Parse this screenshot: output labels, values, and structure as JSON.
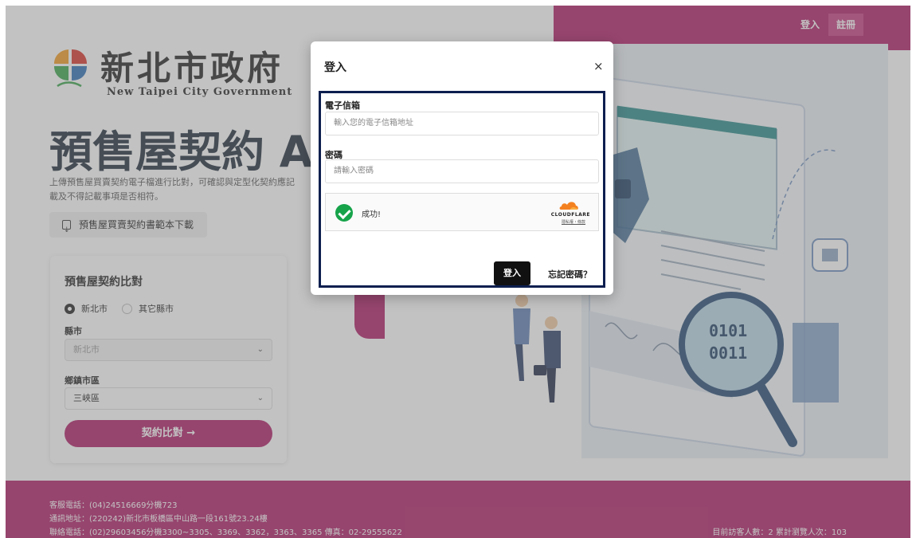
{
  "header": {
    "login_label": "登入",
    "register_label": "註冊"
  },
  "logo": {
    "name_cn": "新北市政府",
    "name_en": "New Taipei City Government"
  },
  "hero": {
    "title": "預售屋契約 AI",
    "description": "上傳預售屋買賣契約電子檔進行比對，可確認與定型化契約應記載及不得記載事項是否相符。",
    "download_label": "預售屋買賣契約書範本下載"
  },
  "compare_card": {
    "title": "預售屋契約比對",
    "radio_options": [
      "新北市",
      "其它縣市"
    ],
    "selected_option": "新北市",
    "county_label": "縣市",
    "county_value": "新北市",
    "district_label": "鄉鎮市區",
    "district_value": "三峽區",
    "submit_label": "契約比對 →"
  },
  "footer": {
    "phone": "客服電話：(04)24516669分機723",
    "address": "通訊地址：(220242)新北市板橋區中山路一段161號23.24樓",
    "contact": "聯絡電話：(02)29603456分機3300~3305、3369、3362，3363、3365 傳真：02-29555622",
    "visits": "目前訪客人數：2 累計瀏覽人次：103"
  },
  "modal": {
    "title": "登入",
    "close_symbol": "×",
    "email_label": "電子信箱",
    "email_placeholder": "輸入您的電子信箱地址",
    "password_label": "密碼",
    "password_placeholder": "請輸入密碼",
    "captcha_status": "成功!",
    "captcha_brand": "CLOUDFLARE",
    "captcha_links": "隱私權・條款",
    "login_label": "登入",
    "forgot_label": "忘記密碼？"
  },
  "colors": {
    "brand": "#b01d66",
    "modal_frame": "#0d1f4f",
    "success": "#16a34a"
  }
}
